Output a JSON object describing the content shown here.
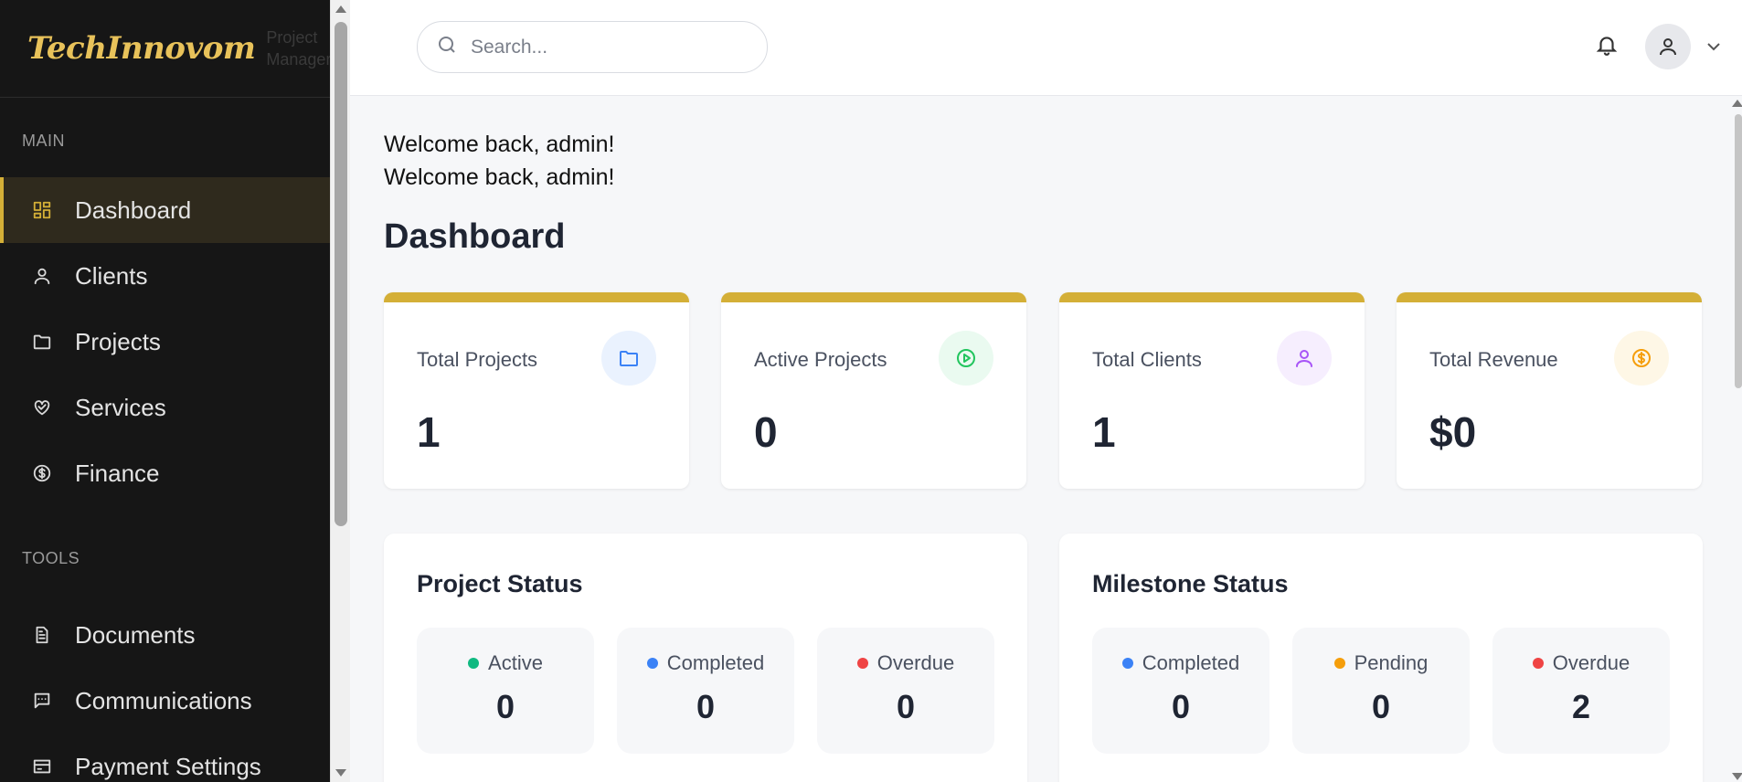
{
  "brand": {
    "logo": "TechInnovom",
    "subtitle_line1": "Project",
    "subtitle_line2": "Manager"
  },
  "sidebar": {
    "section_main": "MAIN",
    "section_tools": "TOOLS",
    "main_items": [
      {
        "label": "Dashboard",
        "icon": "dashboard-icon",
        "active": true
      },
      {
        "label": "Clients",
        "icon": "user-icon"
      },
      {
        "label": "Projects",
        "icon": "folder-icon"
      },
      {
        "label": "Services",
        "icon": "handshake-heart-icon"
      },
      {
        "label": "Finance",
        "icon": "dollar-circle-icon"
      }
    ],
    "tool_items": [
      {
        "label": "Documents",
        "icon": "document-icon"
      },
      {
        "label": "Communications",
        "icon": "message-icon"
      },
      {
        "label": "Payment Settings",
        "icon": "payment-icon"
      }
    ]
  },
  "topbar": {
    "search_placeholder": "Search...",
    "notification_icon": "bell-icon",
    "avatar_icon": "user-icon",
    "menu_icon": "chevron-down-icon"
  },
  "main": {
    "welcome_1": "Welcome back, admin!",
    "welcome_2": "Welcome back, admin!",
    "title": "Dashboard"
  },
  "stats": [
    {
      "label": "Total Projects",
      "value": "1",
      "icon": "folder-icon",
      "icon_color": "#3b82f6",
      "icon_bg": "#eaf2fe"
    },
    {
      "label": "Active Projects",
      "value": "0",
      "icon": "play-circle-icon",
      "icon_color": "#22c55e",
      "icon_bg": "#eafaf0"
    },
    {
      "label": "Total Clients",
      "value": "1",
      "icon": "user-icon",
      "icon_color": "#a855f7",
      "icon_bg": "#f6eefe"
    },
    {
      "label": "Total Revenue",
      "value": "$0",
      "icon": "dollar-circle-icon",
      "icon_color": "#f59e0b",
      "icon_bg": "#fef7e6"
    }
  ],
  "project_status": {
    "title": "Project Status",
    "items": [
      {
        "label": "Active",
        "value": "0",
        "dot_color": "#10b981"
      },
      {
        "label": "Completed",
        "value": "0",
        "dot_color": "#3b82f6"
      },
      {
        "label": "Overdue",
        "value": "0",
        "dot_color": "#ef4444"
      }
    ]
  },
  "milestone_status": {
    "title": "Milestone Status",
    "items": [
      {
        "label": "Completed",
        "value": "0",
        "dot_color": "#3b82f6"
      },
      {
        "label": "Pending",
        "value": "0",
        "dot_color": "#f59e0b"
      },
      {
        "label": "Overdue",
        "value": "2",
        "dot_color": "#ef4444"
      }
    ]
  },
  "accent_color": "#d4af37"
}
